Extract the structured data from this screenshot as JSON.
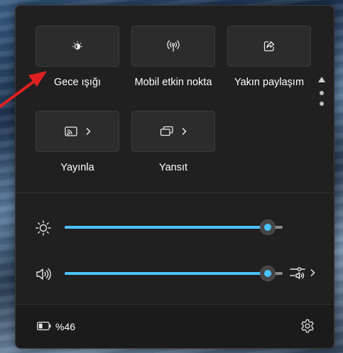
{
  "quick_settings": {
    "tiles": [
      {
        "label": "Gece ışığı",
        "icon": "night-light-icon",
        "active": false
      },
      {
        "label": "Mobil etkin nokta",
        "icon": "mobile-hotspot-icon",
        "active": false
      },
      {
        "label": "Yakın paylaşım",
        "icon": "nearby-share-icon",
        "active": false
      },
      {
        "label": "Yayınla",
        "icon": "cast-icon",
        "has_chevron": true
      },
      {
        "label": "Yansıt",
        "icon": "project-icon",
        "has_chevron": true
      }
    ],
    "pager": {
      "pages": 2,
      "current": 1
    }
  },
  "sliders": {
    "brightness": {
      "icon": "brightness-icon",
      "level": 0.93
    },
    "volume": {
      "icon": "speaker-icon",
      "level": 0.93,
      "extra_icon": "audio-output-icon"
    }
  },
  "footer": {
    "battery_percent": "%46",
    "battery_icon": "battery-icon",
    "settings_icon": "settings-gear-icon"
  },
  "colors": {
    "accent": "#4cc2ff",
    "panel_bg": "#202020",
    "tile_bg": "#2c2c2c",
    "annotation_arrow": "#e02020"
  }
}
